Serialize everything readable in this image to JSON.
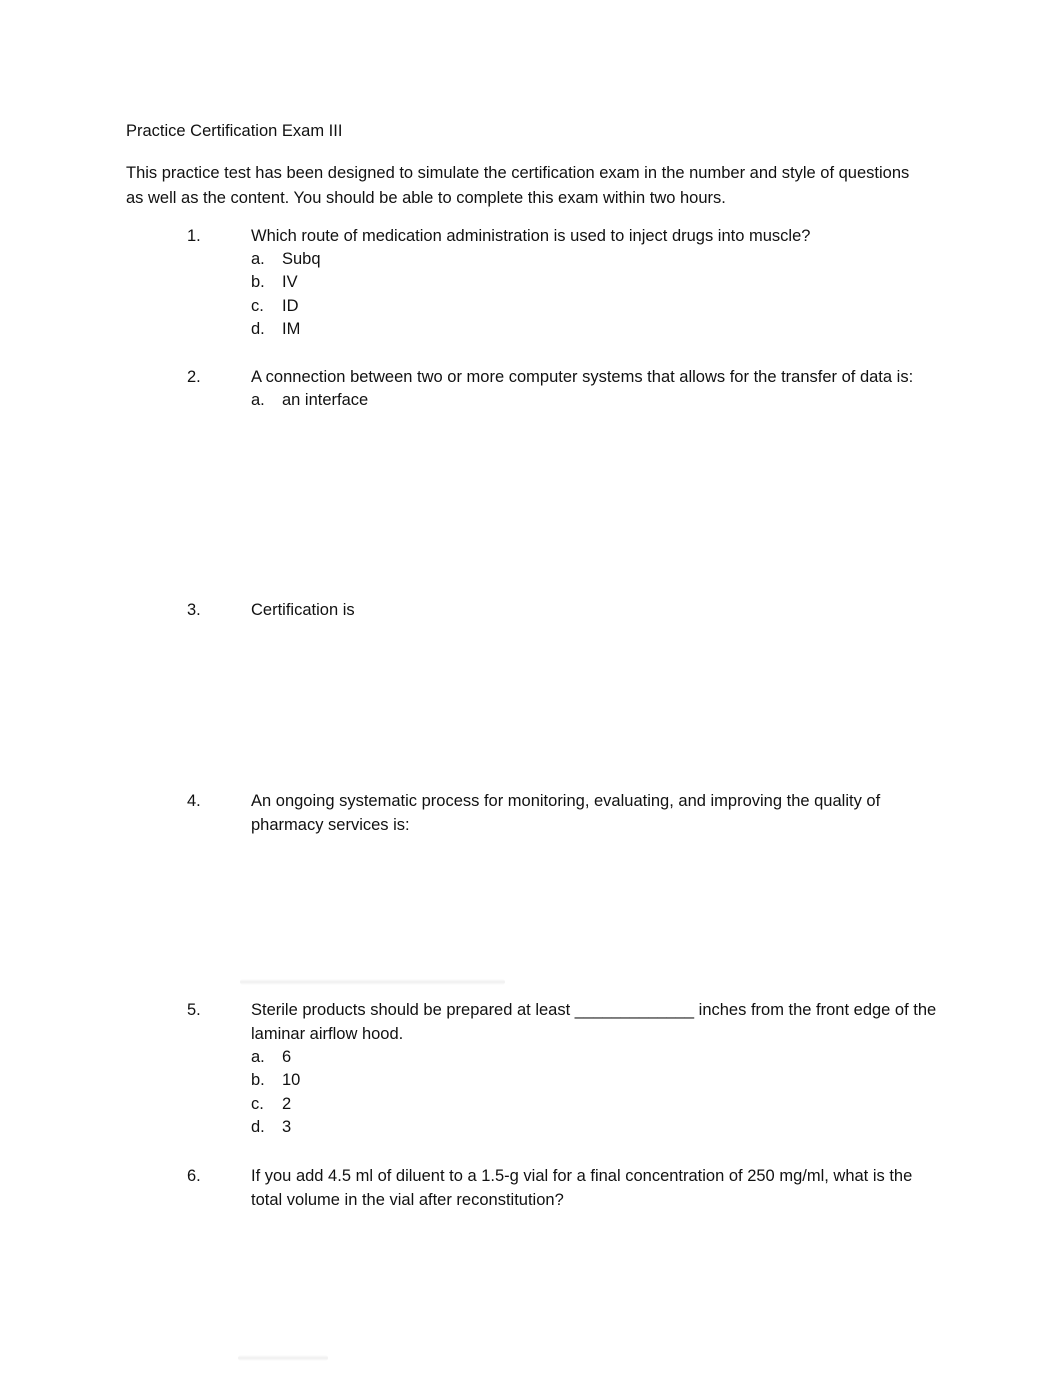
{
  "document": {
    "title": "Practice Certification Exam III",
    "intro": "This practice test has been designed to simulate the certification exam in the number and style of questions as well as the content. You should be able to complete this exam within two hours."
  },
  "questions": [
    {
      "number": "1.",
      "text": "Which route of medication administration is used to inject drugs into muscle?",
      "options": [
        {
          "letter": "a.",
          "text": "Subq"
        },
        {
          "letter": "b.",
          "text": "IV"
        },
        {
          "letter": "c.",
          "text": "ID"
        },
        {
          "letter": "d.",
          "text": "IM"
        }
      ]
    },
    {
      "number": "2.",
      "text": "A connection between two or more computer systems that allows for the transfer of data is:",
      "options": [
        {
          "letter": "a.",
          "text": "an interface"
        }
      ]
    },
    {
      "number": "3.",
      "text": "Certification is",
      "options": []
    },
    {
      "number": "4.",
      "text": "An ongoing systematic process for monitoring, evaluating, and improving the quality of pharmacy services is:",
      "options": []
    },
    {
      "number": "5.",
      "text": "Sterile products should be prepared at least _____________ inches from the front edge of the laminar airflow hood.",
      "options": [
        {
          "letter": "a.",
          "text": "6"
        },
        {
          "letter": "b.",
          "text": "10"
        },
        {
          "letter": "c.",
          "text": "2"
        },
        {
          "letter": "d.",
          "text": "3"
        }
      ]
    },
    {
      "number": "6.",
      "text": "If you add 4.5 ml of diluent to a 1.5-g vial for a final concentration of 250 mg/ml, what is the total volume in the vial after reconstitution?",
      "options": []
    }
  ]
}
